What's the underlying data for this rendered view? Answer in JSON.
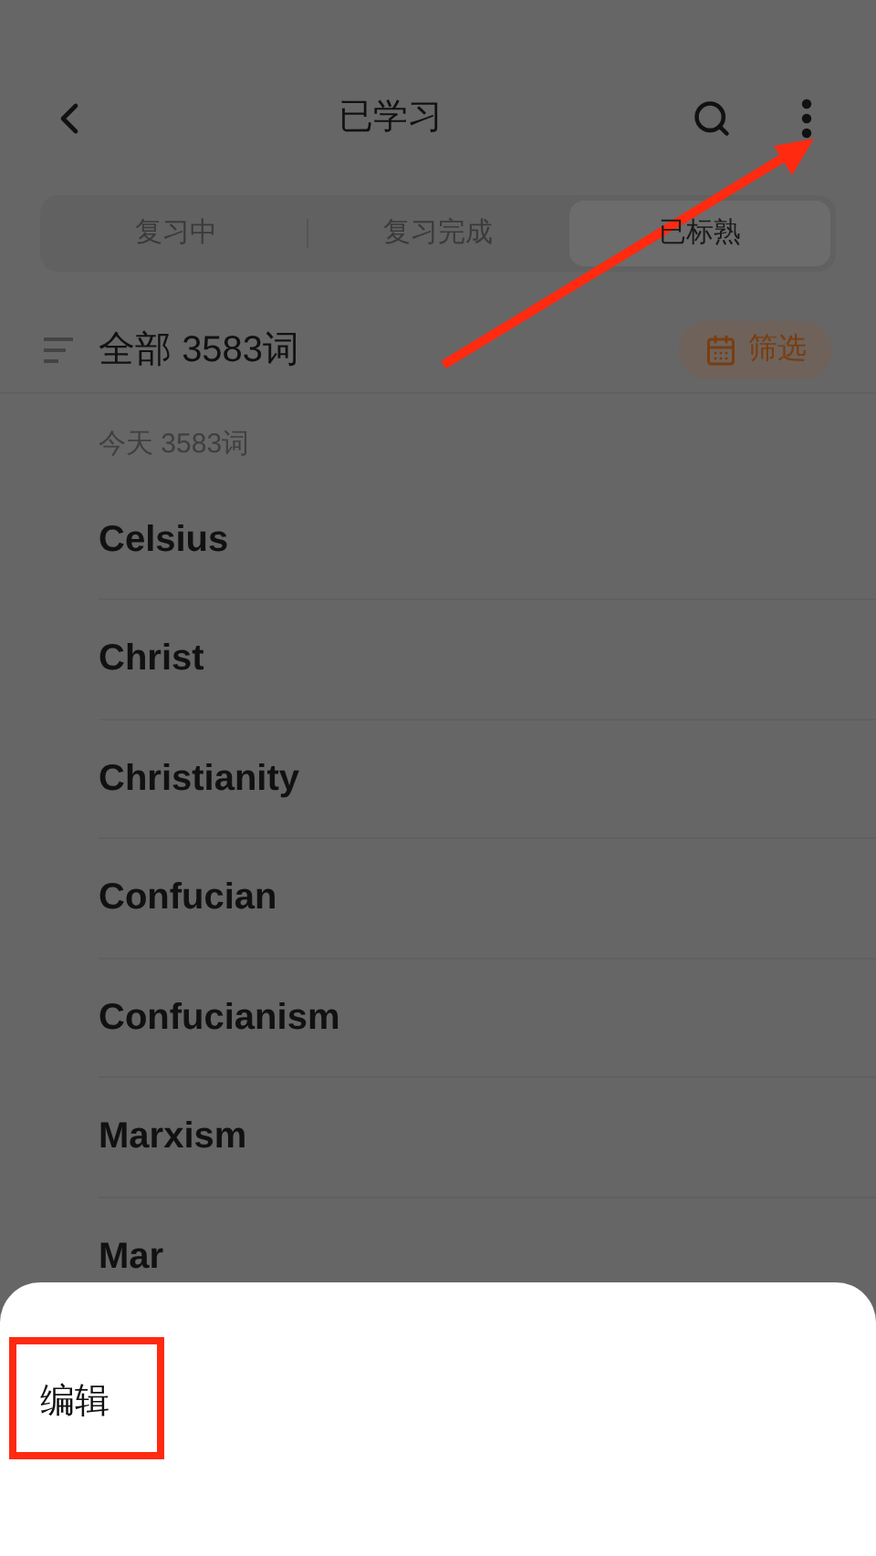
{
  "header": {
    "title": "已学习"
  },
  "tabs": [
    {
      "label": "复习中",
      "selected": false
    },
    {
      "label": "复习完成",
      "selected": false
    },
    {
      "label": "已标熟",
      "selected": true
    }
  ],
  "summary": {
    "label": "全部",
    "count": "3583词",
    "filter_button": "筛选"
  },
  "section": {
    "label": "今天",
    "count": "3583词"
  },
  "words": [
    "Celsius",
    "Christ",
    "Christianity",
    "Confucian",
    "Confucianism",
    "Marxism",
    "Mar"
  ],
  "sheet": {
    "items": [
      "编辑"
    ]
  }
}
